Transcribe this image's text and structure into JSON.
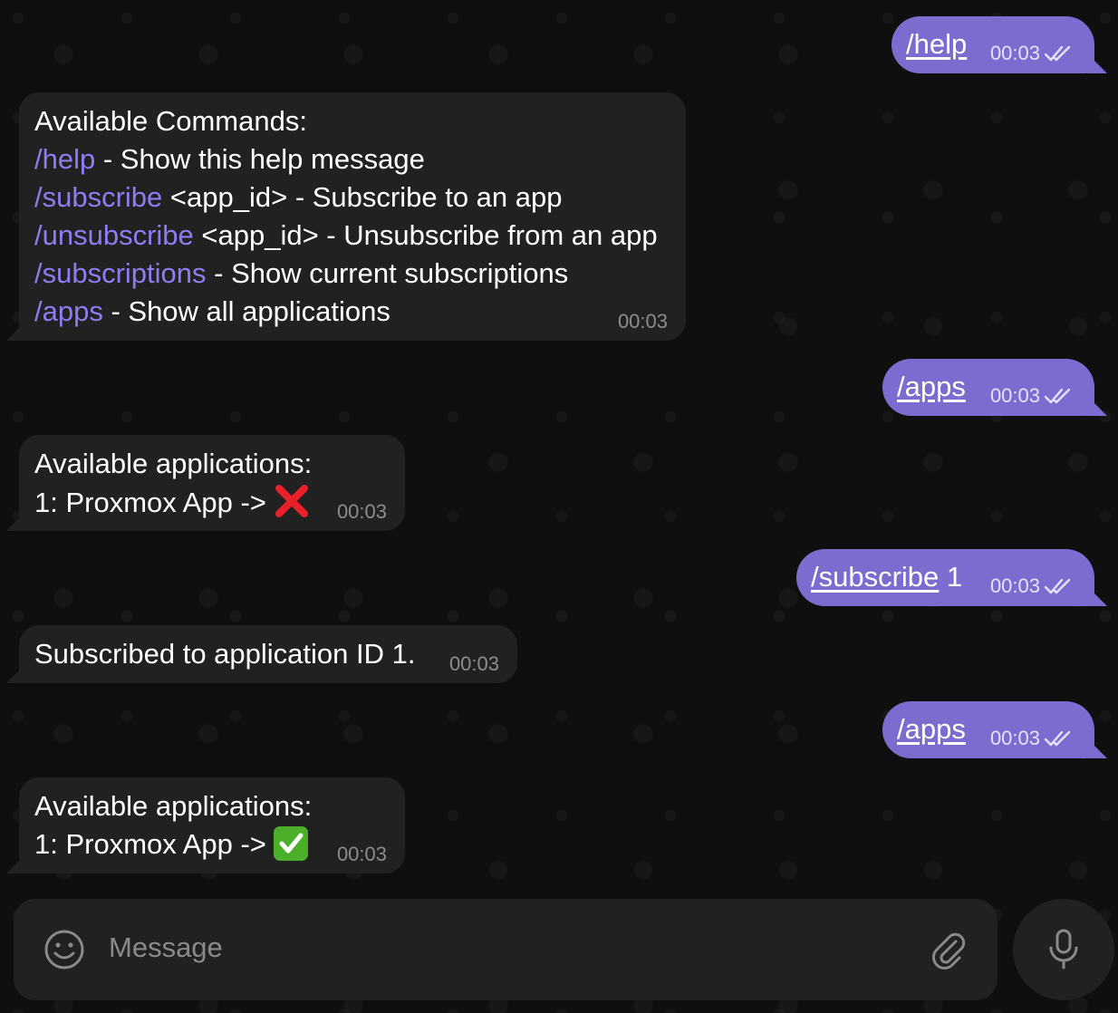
{
  "messages": [
    {
      "dir": "out",
      "command": "/help",
      "time": "00:03"
    },
    {
      "dir": "in",
      "title": "Available Commands:",
      "lines": [
        {
          "cmd": "/help",
          "rest": " - Show this help message"
        },
        {
          "cmd": "/subscribe",
          "rest": " <app_id> - Subscribe to an app"
        },
        {
          "cmd": "/unsubscribe",
          "rest": " <app_id> - Unsubscribe from an app"
        },
        {
          "cmd": "/subscriptions",
          "rest": " - Show current subscriptions"
        },
        {
          "cmd": "/apps",
          "rest": " - Show all applications"
        }
      ],
      "time": "00:03"
    },
    {
      "dir": "out",
      "command": "/apps",
      "time": "00:03"
    },
    {
      "dir": "in",
      "line1": "Available applications:",
      "line2": "1: Proxmox App -> ",
      "status_icon": "cross-mark",
      "time": "00:03"
    },
    {
      "dir": "out",
      "command": "/subscribe",
      "arg": " 1",
      "time": "00:03"
    },
    {
      "dir": "in",
      "text": "Subscribed to application ID 1.",
      "time": "00:03"
    },
    {
      "dir": "out",
      "command": "/apps",
      "time": "00:03"
    },
    {
      "dir": "in",
      "line1": "Available applications:",
      "line2": "1: Proxmox App -> ",
      "status_icon": "check-mark-button",
      "time": "00:03"
    }
  ],
  "composer": {
    "placeholder": "Message"
  },
  "icons": {
    "emoji": "smile-icon",
    "attach": "paperclip-icon",
    "mic": "microphone-icon",
    "read": "double-check-icon"
  },
  "colors": {
    "outgoing": "#7b6ccf",
    "incoming": "#212121",
    "link": "#8c7ef0",
    "background": "#0f0f0f"
  }
}
